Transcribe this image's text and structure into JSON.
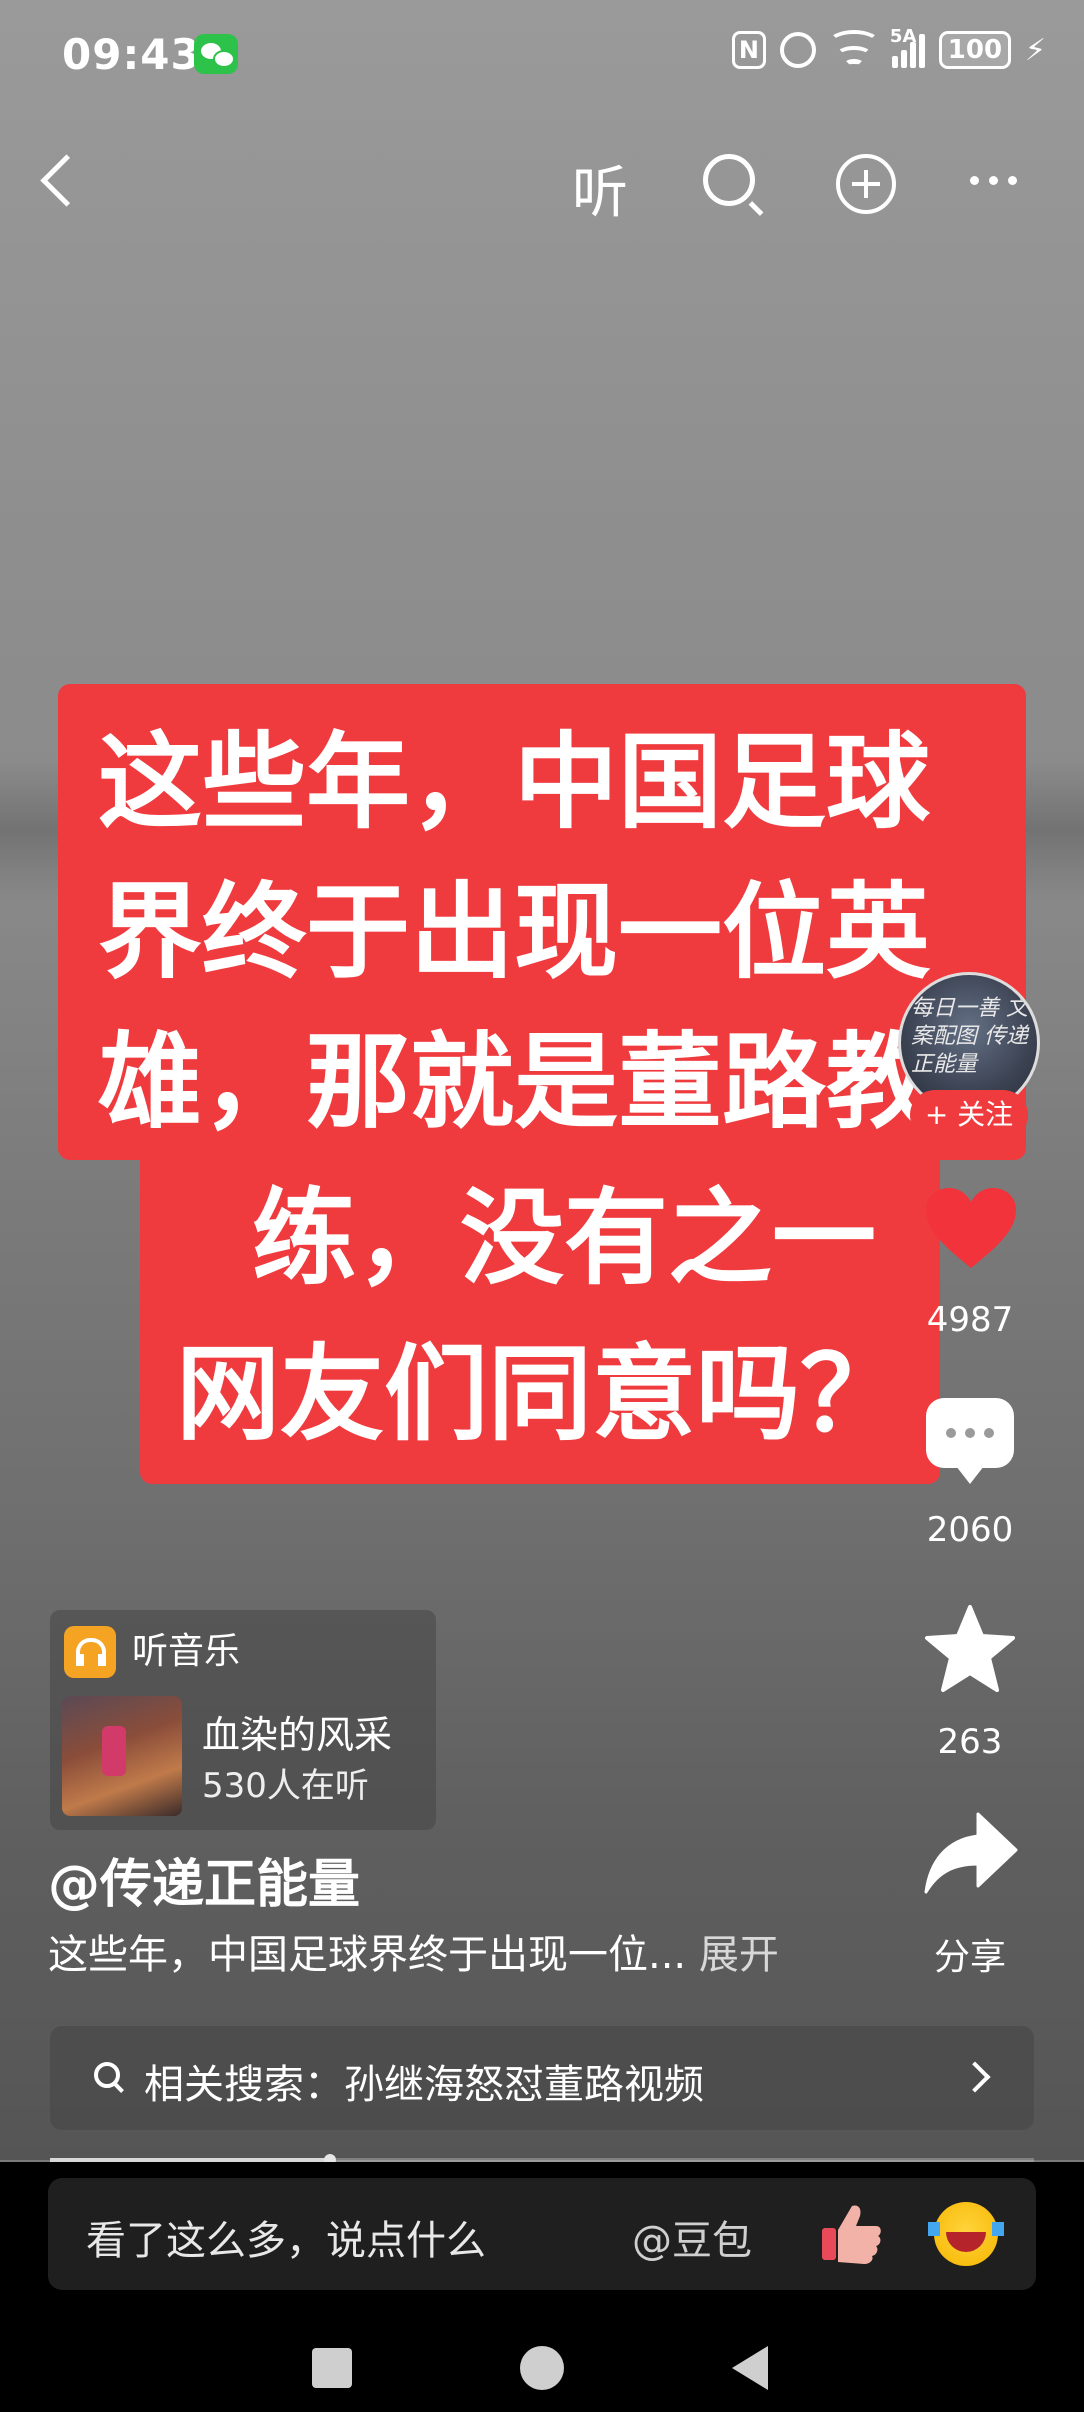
{
  "status_bar": {
    "time": "09:43",
    "network": "5A",
    "battery": "100"
  },
  "top_nav": {
    "listen_label": "听"
  },
  "caption": {
    "lines_top": [
      "这些年，中国足球",
      "界终于出现一位英",
      "雄，那就是董路教"
    ],
    "lines_bottom": [
      "练，没有之一",
      "网友们同意吗？"
    ]
  },
  "creator": {
    "avatar_text": "每日一善 文案配图 传递正能量",
    "follow_label": "+ 关注"
  },
  "actions": {
    "likes": "4987",
    "comments": "2060",
    "favorites": "263",
    "share_label": "分享"
  },
  "music": {
    "label": "听音乐",
    "song": "血染的风采",
    "listeners": "530人在听"
  },
  "post": {
    "author": "@传递正能量",
    "description": "这些年，中国足球界终于出现一位...",
    "expand_label": "展开"
  },
  "related_search": {
    "text": "相关搜索：孙继海怒怼董路视频"
  },
  "playback": {
    "progress_fraction": 0.285
  },
  "comment_bar": {
    "placeholder": "看了这么多，说点什么",
    "mention": "@豆包"
  },
  "colors": {
    "caption_red": "#ef3a3e",
    "like_red": "#f2333b",
    "music_orange": "#f4a323"
  },
  "icons": [
    "back-icon",
    "search-icon",
    "add-icon",
    "more-icon",
    "heart-icon",
    "comment-icon",
    "star-icon",
    "share-icon",
    "headphones-icon",
    "thumbs-up-icon",
    "laugh-cry-emoji-icon"
  ]
}
